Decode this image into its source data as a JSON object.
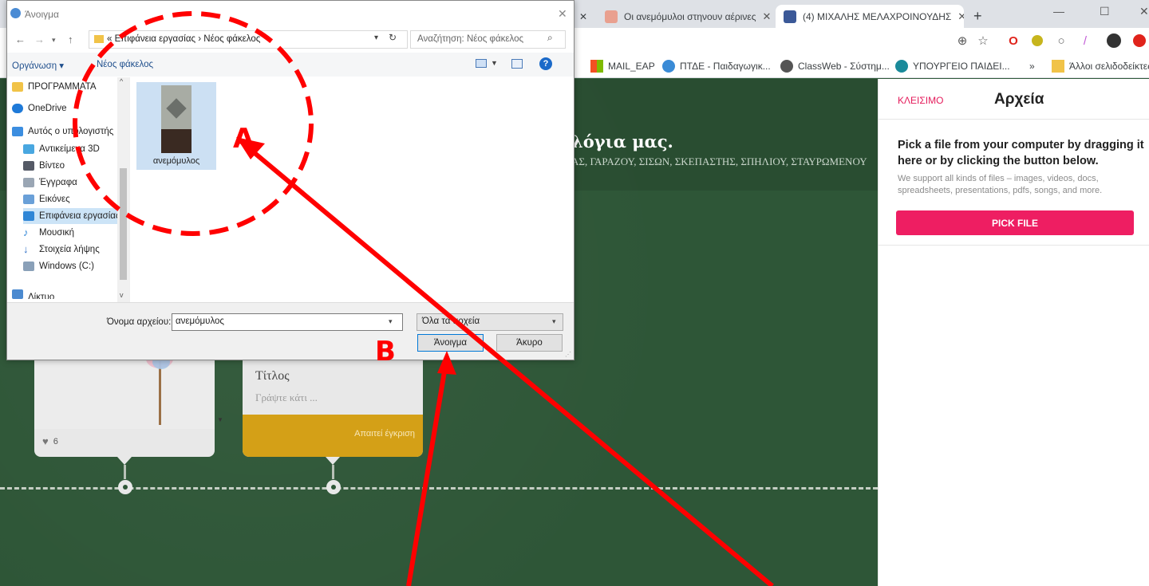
{
  "browser": {
    "tabs": [
      {
        "label": "Οι ανεμόμυλοι στηνουν αέρινες",
        "favicon_color": "#e9a08f"
      },
      {
        "label": "(4) ΜΙΧΑΛΗΣ ΜΕΛΑΧΡΟΙΝΟΥΔΗΣ",
        "favicon_color": "#3b5998"
      }
    ],
    "new_tab": "+",
    "bookmarks": [
      {
        "label": "MAIL_EAP",
        "icon": "microsoft-tiles-icon"
      },
      {
        "label": "ΠΤΔΕ - Παιδαγωγικ...",
        "icon": "ptde-icon"
      },
      {
        "label": "ClassWeb - Σύστημ...",
        "icon": "classweb-icon"
      },
      {
        "label": "ΥΠΟΥΡΓΕΙΟ ΠΑΙΔΕΙ...",
        "icon": "ministry-icon"
      }
    ],
    "bookmarks_more": "»",
    "other_bookmarks": "Άλλοι σελιδοδείκτες"
  },
  "page": {
    "title": "λόγια μας.",
    "subtitle": "ΑΣ, ΓΑΡΑΖΟΥ, ΣΙΣΩΝ, ΣΚΕΠΑΣΤΗΣ, ΣΠΗΛΙΟΥ, ΣΤΑΥΡΩΜΕΝΟΥ",
    "posts": [
      {
        "likes": "6"
      },
      {
        "title": "Τίτλος",
        "body_placeholder": "Γράψτε κάτι ...",
        "status": "Απαιτεί έγκριση"
      }
    ]
  },
  "files_panel": {
    "close_label": "ΚΛΕΙΣΙΜΟ",
    "title": "Αρχεία",
    "lead": "Pick a file from your computer by dragging it here or by clicking the button below.",
    "description": "We support all kinds of files – images, videos, docs, spreadsheets, presentations, pdfs, songs, and more.",
    "pick_button": "PICK FILE"
  },
  "dialog": {
    "title": "Άνοιγμα",
    "address": "« Επιφάνεια εργασίας › Νέος φάκελος",
    "search_placeholder": "Αναζήτηση: Νέος φάκελος",
    "organize": "Οργάνωση ▾",
    "new_folder": "Νέος φάκελος",
    "nav_items": [
      {
        "label": "ΠΡΟΓΡΑΜΜΑΤΑ",
        "color": "#f1c348"
      },
      {
        "label": "OneDrive",
        "color": "#1f7ad8"
      },
      {
        "label": "Αυτός ο υπολογιστής",
        "color": "#3c8ee0"
      },
      {
        "label": "Αντικείμενα 3D",
        "color": "#49a7e0"
      },
      {
        "label": "Βίντεο",
        "color": "#555a66"
      },
      {
        "label": "Έγγραφα",
        "color": "#9aa6b4"
      },
      {
        "label": "Εικόνες",
        "color": "#6aa0d8"
      },
      {
        "label": "Επιφάνεια εργασίας",
        "color": "#2f86d6"
      },
      {
        "label": "Μουσική",
        "color": "#2f86d6"
      },
      {
        "label": "Στοιχεία λήψης",
        "color": "#2f6fc6"
      },
      {
        "label": "Windows (C:)",
        "color": "#8aa0b8"
      },
      {
        "label": "Δίκτυο",
        "color": "#4b8ad0"
      }
    ],
    "file": {
      "name": "ανεμόμυλος"
    },
    "filename_label": "Όνομα αρχείου:",
    "filename_value": "ανεμόμυλος",
    "filetype": "Όλα τα αρχεία",
    "open_button": "Άνοιγμα",
    "cancel_button": "Άκυρο"
  },
  "annotations": {
    "label_a": "A",
    "label_b": "B",
    "color": "#ff0000"
  }
}
